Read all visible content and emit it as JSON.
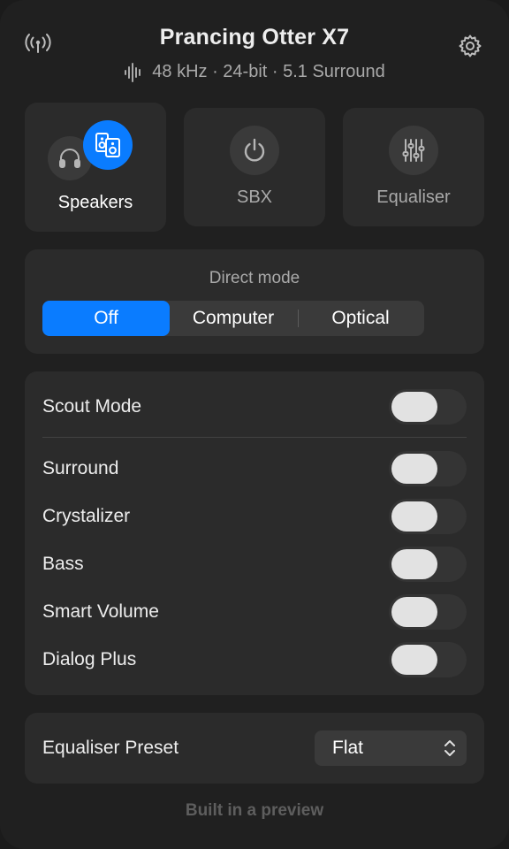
{
  "header": {
    "device_name": "Prancing Otter X7",
    "audio_format": "48 kHz · 24-bit · 5.1 Surround",
    "icons": {
      "left": "antenna-icon",
      "right": "gear-icon",
      "format": "waveform-icon"
    }
  },
  "modes": [
    {
      "label": "Speakers",
      "icon": "speakers-icon",
      "selected": true
    },
    {
      "label": "SBX",
      "icon": "power-icon",
      "selected": false
    },
    {
      "label": "Equaliser",
      "icon": "sliders-icon",
      "selected": false
    }
  ],
  "direct_mode": {
    "label": "Direct mode",
    "options": [
      "Off",
      "Computer",
      "Optical"
    ],
    "selected": "Off"
  },
  "toggles": [
    {
      "label": "Scout Mode",
      "on": false
    },
    {
      "label": "Surround",
      "on": false
    },
    {
      "label": "Crystalizer",
      "on": false
    },
    {
      "label": "Bass",
      "on": false
    },
    {
      "label": "Smart Volume",
      "on": false
    },
    {
      "label": "Dialog Plus",
      "on": false
    }
  ],
  "equaliser_preset": {
    "label": "Equaliser Preset",
    "value": "Flat"
  },
  "footer": "Built in a preview",
  "colors": {
    "accent": "#0a7cff",
    "panel": "#202020",
    "card": "#2b2b2b"
  }
}
